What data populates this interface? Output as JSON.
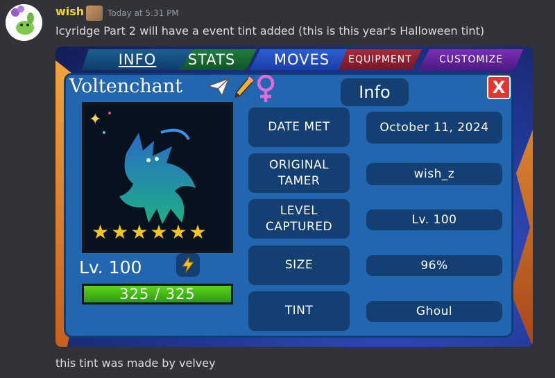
{
  "message": {
    "username": "wish",
    "timestamp": "Today at 5:31 PM",
    "text": "Icyridge Part 2 will have a event tint added (this is this year's Halloween tint)",
    "followup": "this tint was made by velvey"
  },
  "game": {
    "tabs": [
      "INFO",
      "STATS",
      "MOVES",
      "EQUIPMENT",
      "CUSTOMIZE"
    ],
    "active_tab": "INFO",
    "panel_title": "Info",
    "close_label": "X",
    "creature": {
      "name": "Voltenchant",
      "level": "Lv. 100",
      "stars": 6,
      "hp_text": "325 / 325",
      "hp_fraction": 1.0
    },
    "fields": [
      {
        "label": "DATE MET",
        "value": "October 11, 2024"
      },
      {
        "label": "ORIGINAL TAMER",
        "value": "wish_z"
      },
      {
        "label": "LEVEL CAPTURED",
        "value": "Lv. 100"
      },
      {
        "label": "SIZE",
        "value": "96%"
      },
      {
        "label": "TINT",
        "value": "Ghoul"
      }
    ],
    "icons": [
      "paper-plane-icon",
      "pencil-icon",
      "female-icon",
      "lightning-bolt-icon"
    ],
    "colors": {
      "close": "#e2362e",
      "star": "#f5c518",
      "hp": "#5cd51d",
      "panel": "#2166ae"
    }
  }
}
